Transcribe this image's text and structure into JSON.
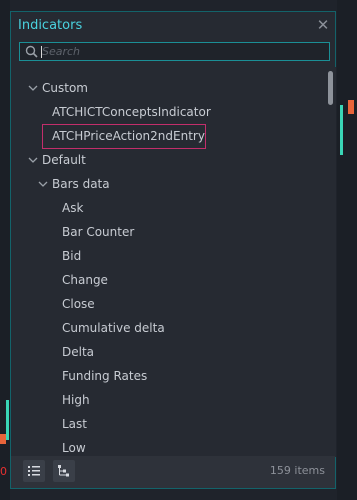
{
  "panel": {
    "title": "Indicators",
    "close_icon": "close-icon",
    "search": {
      "placeholder": "Search",
      "value": ""
    }
  },
  "tree": [
    {
      "label": "Custom",
      "level": 0,
      "expandable": true,
      "expanded": true
    },
    {
      "label": "ATCHICTConceptsIndicator",
      "level": 1,
      "expandable": false
    },
    {
      "label": "ATCHPriceAction2ndEntry",
      "level": 1,
      "expandable": false,
      "highlighted": true
    },
    {
      "label": "Default",
      "level": 0,
      "expandable": true,
      "expanded": true
    },
    {
      "label": "Bars data",
      "level": 1,
      "expandable": true,
      "expanded": true
    },
    {
      "label": "Ask",
      "level": 2
    },
    {
      "label": "Bar Counter",
      "level": 2
    },
    {
      "label": "Bid",
      "level": 2
    },
    {
      "label": "Change",
      "level": 2
    },
    {
      "label": "Close",
      "level": 2
    },
    {
      "label": "Cumulative delta",
      "level": 2
    },
    {
      "label": "Delta",
      "level": 2
    },
    {
      "label": "Funding Rates",
      "level": 2
    },
    {
      "label": "High",
      "level": 2
    },
    {
      "label": "Last",
      "level": 2
    },
    {
      "label": "Low",
      "level": 2
    }
  ],
  "footer": {
    "list_view_icon": "list-view-icon",
    "tree_view_icon": "tree-view-icon",
    "count": "159 items"
  },
  "background": {
    "edge_text": "0"
  },
  "colors": {
    "accent": "#4ad2df",
    "highlight_border": "#c22e6b",
    "panel_bg": "#262a32",
    "candle_red": "#e8643a",
    "candle_green": "#3ad6b6"
  }
}
